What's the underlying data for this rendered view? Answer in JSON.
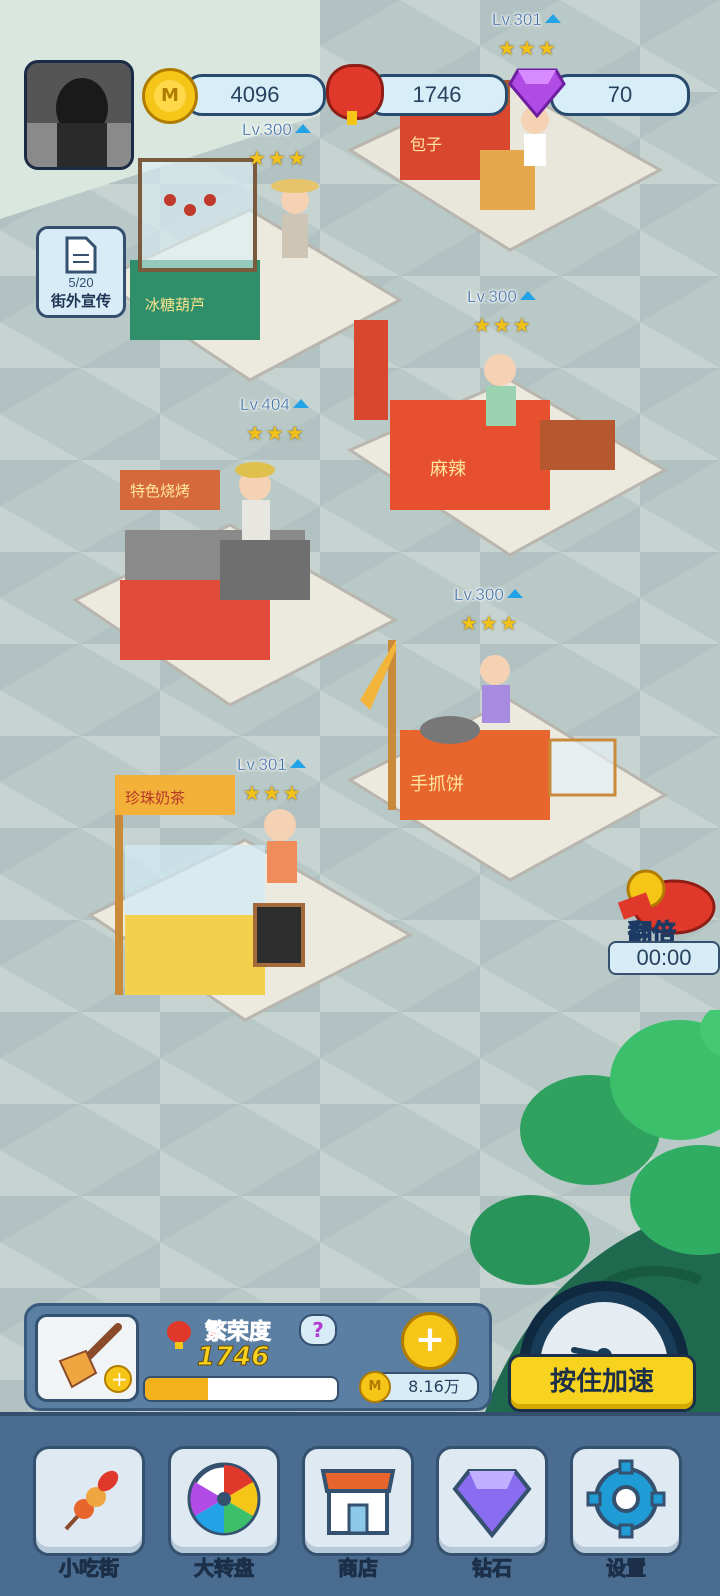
{
  "resources": {
    "coins": "4096",
    "lanterns": "1746",
    "gems": "70"
  },
  "promo": {
    "count": "5/20",
    "label": "街外宣传"
  },
  "stalls": [
    {
      "id": "steamed-bun",
      "level": "Lv.301",
      "stars": "★★★",
      "sign": "包子"
    },
    {
      "id": "candied-haws",
      "level": "Lv.300",
      "stars": "★★★",
      "sign": "冰糖葫芦"
    },
    {
      "id": "spicy-hotpot",
      "level": "Lv.300",
      "stars": "★★★",
      "sign": "麻辣"
    },
    {
      "id": "bbq",
      "level": "Lv.404",
      "stars": "★★★",
      "sign": "特色烧烤"
    },
    {
      "id": "pancake",
      "level": "Lv.300",
      "stars": "★★★",
      "sign": "手抓饼"
    },
    {
      "id": "milk-tea",
      "level": "Lv.301",
      "stars": "★★★",
      "sign": "珍珠奶茶"
    }
  ],
  "double": {
    "label": "翻倍",
    "timer": "00:00"
  },
  "prosperity": {
    "label": "繁荣度",
    "value": "1746",
    "help": "?",
    "progress": 0.33,
    "income": "8.16万"
  },
  "speed_button": "按住加速",
  "nav": [
    {
      "label": "小吃街",
      "icon": "skewer-icon"
    },
    {
      "label": "大转盘",
      "icon": "wheel-icon"
    },
    {
      "label": "商店",
      "icon": "shop-icon"
    },
    {
      "label": "钻石",
      "icon": "diamond-icon"
    },
    {
      "label": "设置",
      "icon": "gear-icon"
    }
  ],
  "colors": {
    "accent_yellow": "#f7d21e",
    "panel_blue": "#4a6c90",
    "level_blue": "#3f6fa3"
  }
}
